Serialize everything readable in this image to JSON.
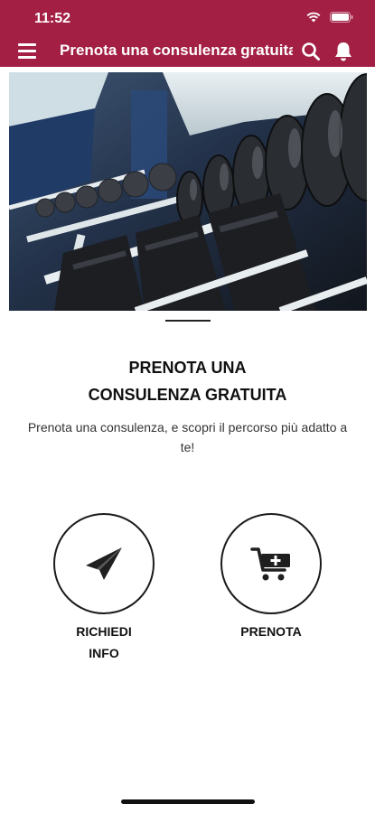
{
  "status": {
    "time": "11:52"
  },
  "header": {
    "title": "Prenota una consulenza gratuita",
    "menu_icon": "hamburger-icon",
    "search_icon": "search-icon",
    "bell_icon": "bell-icon",
    "accent": "#a31f44"
  },
  "main": {
    "hero_icon": "dumbbell-rack-image",
    "title_line1": "PRENOTA UNA",
    "title_line2": "CONSULENZA GRATUITA",
    "subtitle": "Prenota una consulenza, e scopri il percorso più adatto a te!",
    "actions": [
      {
        "line1": "RICHIEDI",
        "line2": "INFO",
        "icon": "paper-plane-icon"
      },
      {
        "line1": "PRENOTA",
        "line2": "",
        "icon": "cart-add-icon"
      }
    ]
  }
}
